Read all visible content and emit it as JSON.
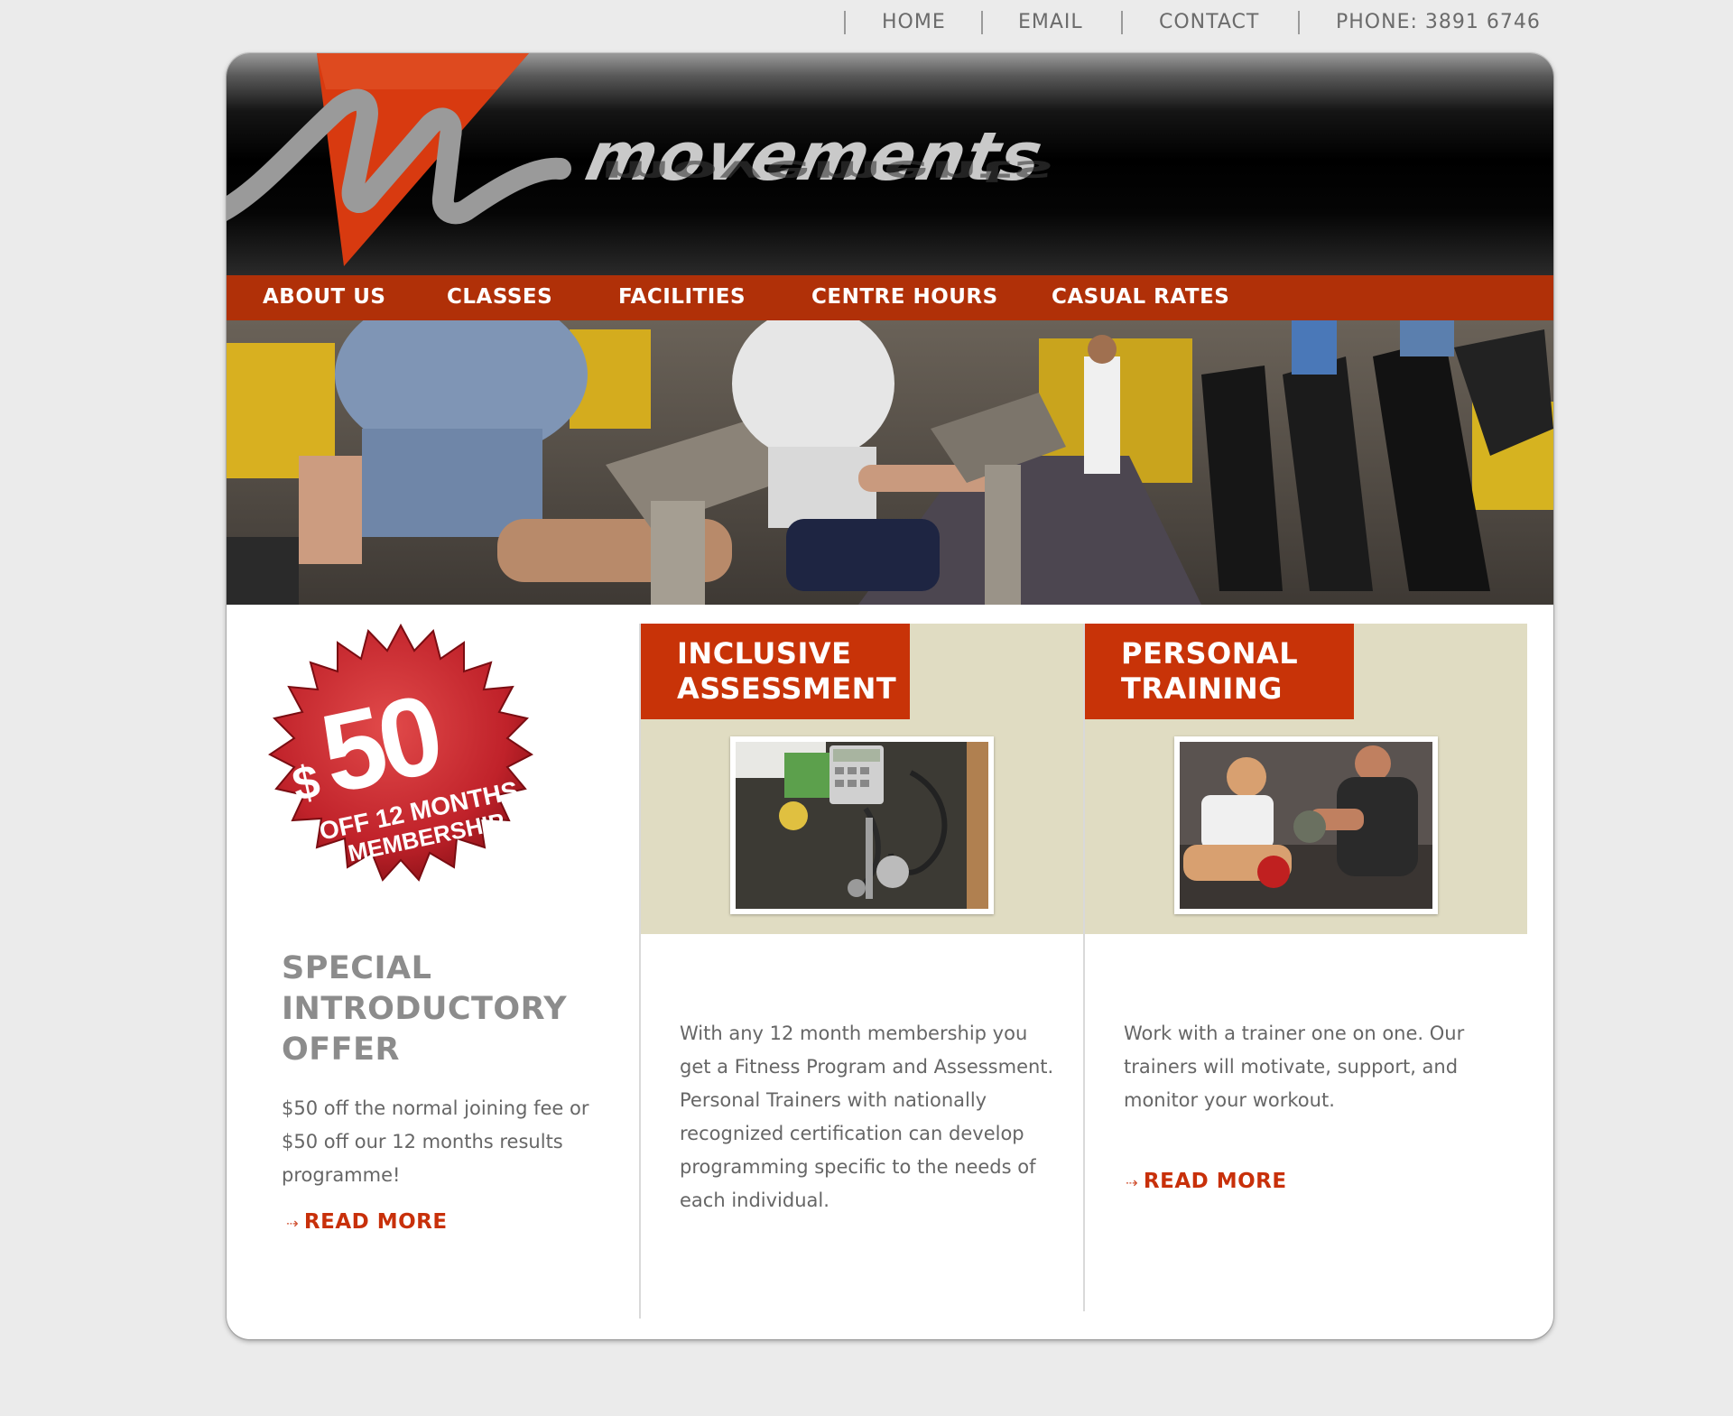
{
  "topnav": {
    "home": "HOME",
    "email": "EMAIL",
    "contact": "CONTACT",
    "phone": "PHONE: 3891 6746"
  },
  "brand": {
    "name": "movements"
  },
  "mainnav": {
    "items": [
      {
        "label": "ABOUT US"
      },
      {
        "label": "CLASSES"
      },
      {
        "label": "FACILITIES"
      },
      {
        "label": "CENTRE HOURS"
      },
      {
        "label": "CASUAL RATES"
      }
    ]
  },
  "promo": {
    "badge_amount": "$50",
    "badge_line1": "OFF 12 MONTHS",
    "badge_line2": "MEMBERSHIP",
    "title": "SPECIAL INTRODUCTORY OFFER",
    "text": "$50 off the normal joining fee or $50 off our 12 months results programme!",
    "read_more": "READ MORE"
  },
  "features": [
    {
      "title_line1": "INCLUSIVE",
      "title_line2": "ASSESSMENT",
      "text": "With any 12 month membership you get a Fitness Program and Assessment. Personal Trainers with nationally recognized certification can develop programming specific to the needs of each individual."
    },
    {
      "title_line1": "PERSONAL",
      "title_line2": "TRAINING",
      "text": "Work with a trainer one on one. Our trainers will motivate, support, and monitor your workout.",
      "read_more": "READ MORE"
    }
  ],
  "colors": {
    "accent": "#c83308",
    "nav_bg": "#b03008",
    "feature_bg": "#e0dcc2",
    "page_bg": "#ebebeb"
  }
}
